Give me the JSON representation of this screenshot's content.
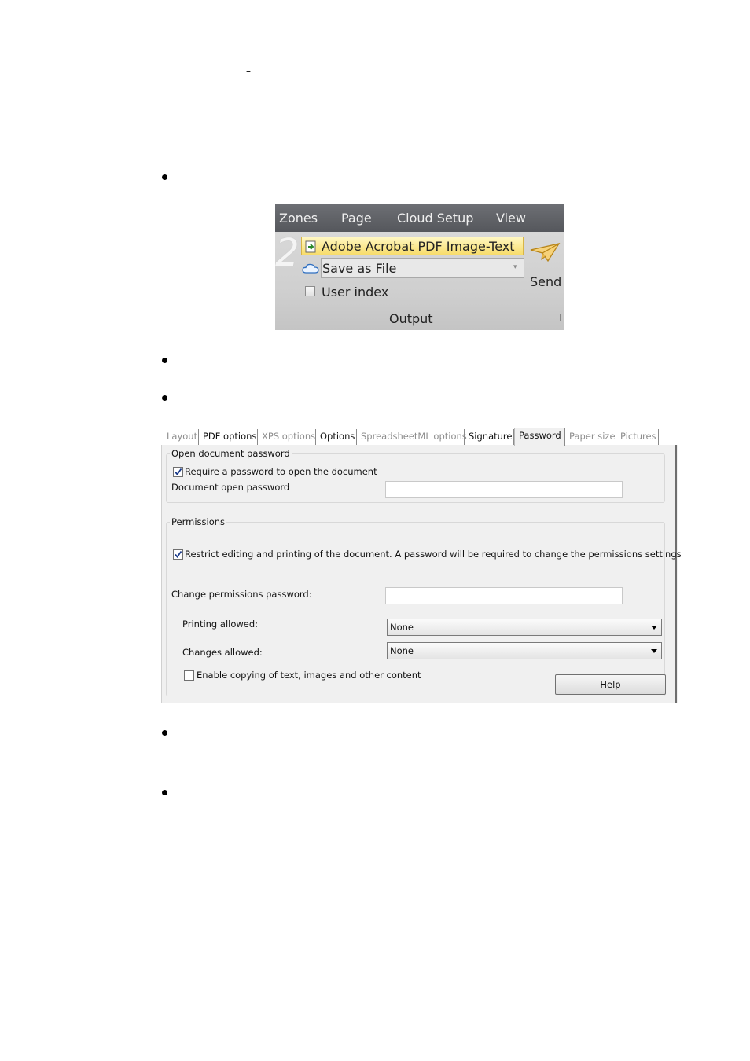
{
  "header": {
    "mark": "–"
  },
  "ribbon": {
    "tabs": [
      "Zones",
      "Page",
      "Cloud Setup",
      "View"
    ],
    "step_number": "2",
    "format_value": "Adobe Acrobat PDF Image-Text",
    "destination_value": "Save as File",
    "user_index_label": "User index",
    "send_label": "Send",
    "group_label": "Output",
    "colors": {
      "tab_bar": "#5f6166",
      "highlight": "#f7dc6b",
      "body": "#d4d4d4"
    }
  },
  "dialog": {
    "tabs": [
      {
        "label": "Layout",
        "disabled": true
      },
      {
        "label": "PDF options",
        "disabled": false
      },
      {
        "label": "XPS options",
        "disabled": true
      },
      {
        "label": "Options",
        "disabled": false
      },
      {
        "label": "SpreadsheetML options",
        "disabled": true
      },
      {
        "label": "Signature",
        "disabled": false
      },
      {
        "label": "Password",
        "disabled": false,
        "active": true
      },
      {
        "label": "Paper size",
        "disabled": true
      },
      {
        "label": "Pictures",
        "disabled": true
      }
    ],
    "open_group": {
      "title": "Open document password",
      "require_label": "Require a password to open the document",
      "require_checked": true,
      "password_label": "Document open password",
      "password_value": ""
    },
    "permissions_group": {
      "title": "Permissions",
      "restrict_label": "Restrict editing and printing of the document. A password will be required to change the permissions settings",
      "restrict_checked": true,
      "change_password_label": "Change permissions password:",
      "change_password_value": "",
      "printing_label": "Printing allowed:",
      "printing_value": "None",
      "changes_label": "Changes allowed:",
      "changes_value": "None",
      "copy_label": "Enable copying of text, images and other content",
      "copy_checked": false
    },
    "help_label": "Help"
  }
}
